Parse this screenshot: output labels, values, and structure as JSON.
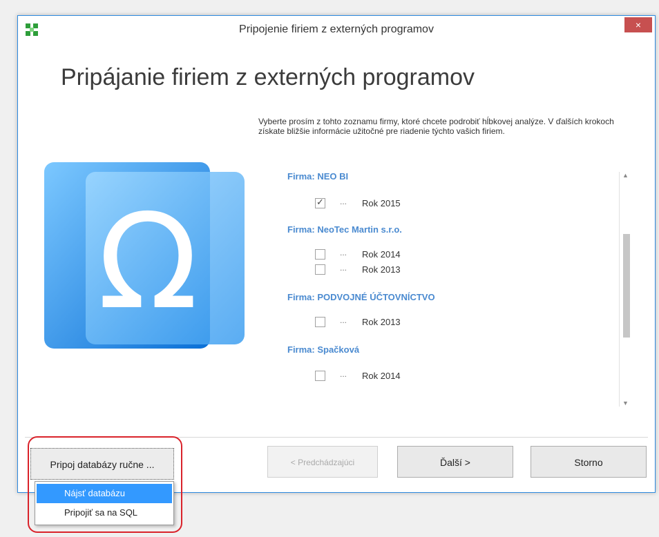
{
  "window": {
    "title": "Pripojenie firiem z externých programov",
    "close_symbol": "×",
    "heading": "Pripájanie firiem z externých programov",
    "intro": "Vyberte prosím z tohto zoznamu firmy, ktoré chcete podrobiť hĺbkovej analýze. V ďalších krokoch získate bližšie informácie užitočné pre riadenie týchto vašich firiem."
  },
  "firms": [
    {
      "label": "Firma: NEO BI",
      "years": [
        {
          "label": "Rok 2015",
          "checked": true
        }
      ]
    },
    {
      "label": "Firma: NeoTec Martin s.r.o.",
      "years": [
        {
          "label": "Rok 2014",
          "checked": false
        },
        {
          "label": "Rok 2013",
          "checked": false
        }
      ]
    },
    {
      "label": "Firma: PODVOJNÉ ÚČTOVNÍCTVO",
      "years": [
        {
          "label": "Rok 2013",
          "checked": false
        }
      ]
    },
    {
      "label": "Firma: Spačková",
      "years": [
        {
          "label": "Rok 2014",
          "checked": false
        }
      ]
    }
  ],
  "dots": "...",
  "buttons": {
    "manual": "Pripoj databázy ručne ...",
    "prev": "< Predchádzajúci",
    "next": "Ďalší >",
    "cancel": "Storno"
  },
  "menu": {
    "items": [
      "Nájsť databázu",
      "Pripojiť sa na SQL"
    ]
  },
  "colors": {
    "accent": "#3399ff",
    "firm_label": "#4a8ad0",
    "highlight": "#d9222a"
  }
}
